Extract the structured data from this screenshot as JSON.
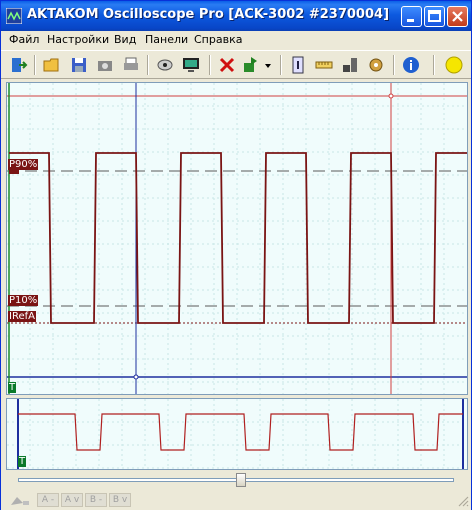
{
  "window": {
    "title": "AKTAKOM Oscilloscope Pro [ACK-3002 #2370004]"
  },
  "menu": {
    "items": [
      "Файл",
      "Настройки",
      "Вид",
      "Панели",
      "Справка"
    ]
  },
  "toolbar": {
    "buttons": [
      "exit-icon",
      "open-folder-icon",
      "save-icon",
      "camera-icon",
      "print-icon",
      "screenshot-icon",
      "monitor-icon",
      "delete-icon",
      "export-icon",
      "dropdown-arrow-icon",
      "info-panel-icon",
      "ruler-icon",
      "tools-icon",
      "settings-icon",
      "about-icon",
      "status-led-icon"
    ],
    "led_color": "#f5e600"
  },
  "main_plot": {
    "markers": {
      "p90": "P90%",
      "p10": "P10%",
      "iref": "IRefA",
      "trigger": "T"
    },
    "signal_color": "#7a1414",
    "grid_color": "#c8e6e6"
  },
  "mini_plot": {
    "trigger": "T",
    "signal_color": "#b02020"
  },
  "statusbar": {
    "buttons": [
      "A -",
      "A v",
      "B -",
      "B v"
    ]
  }
}
